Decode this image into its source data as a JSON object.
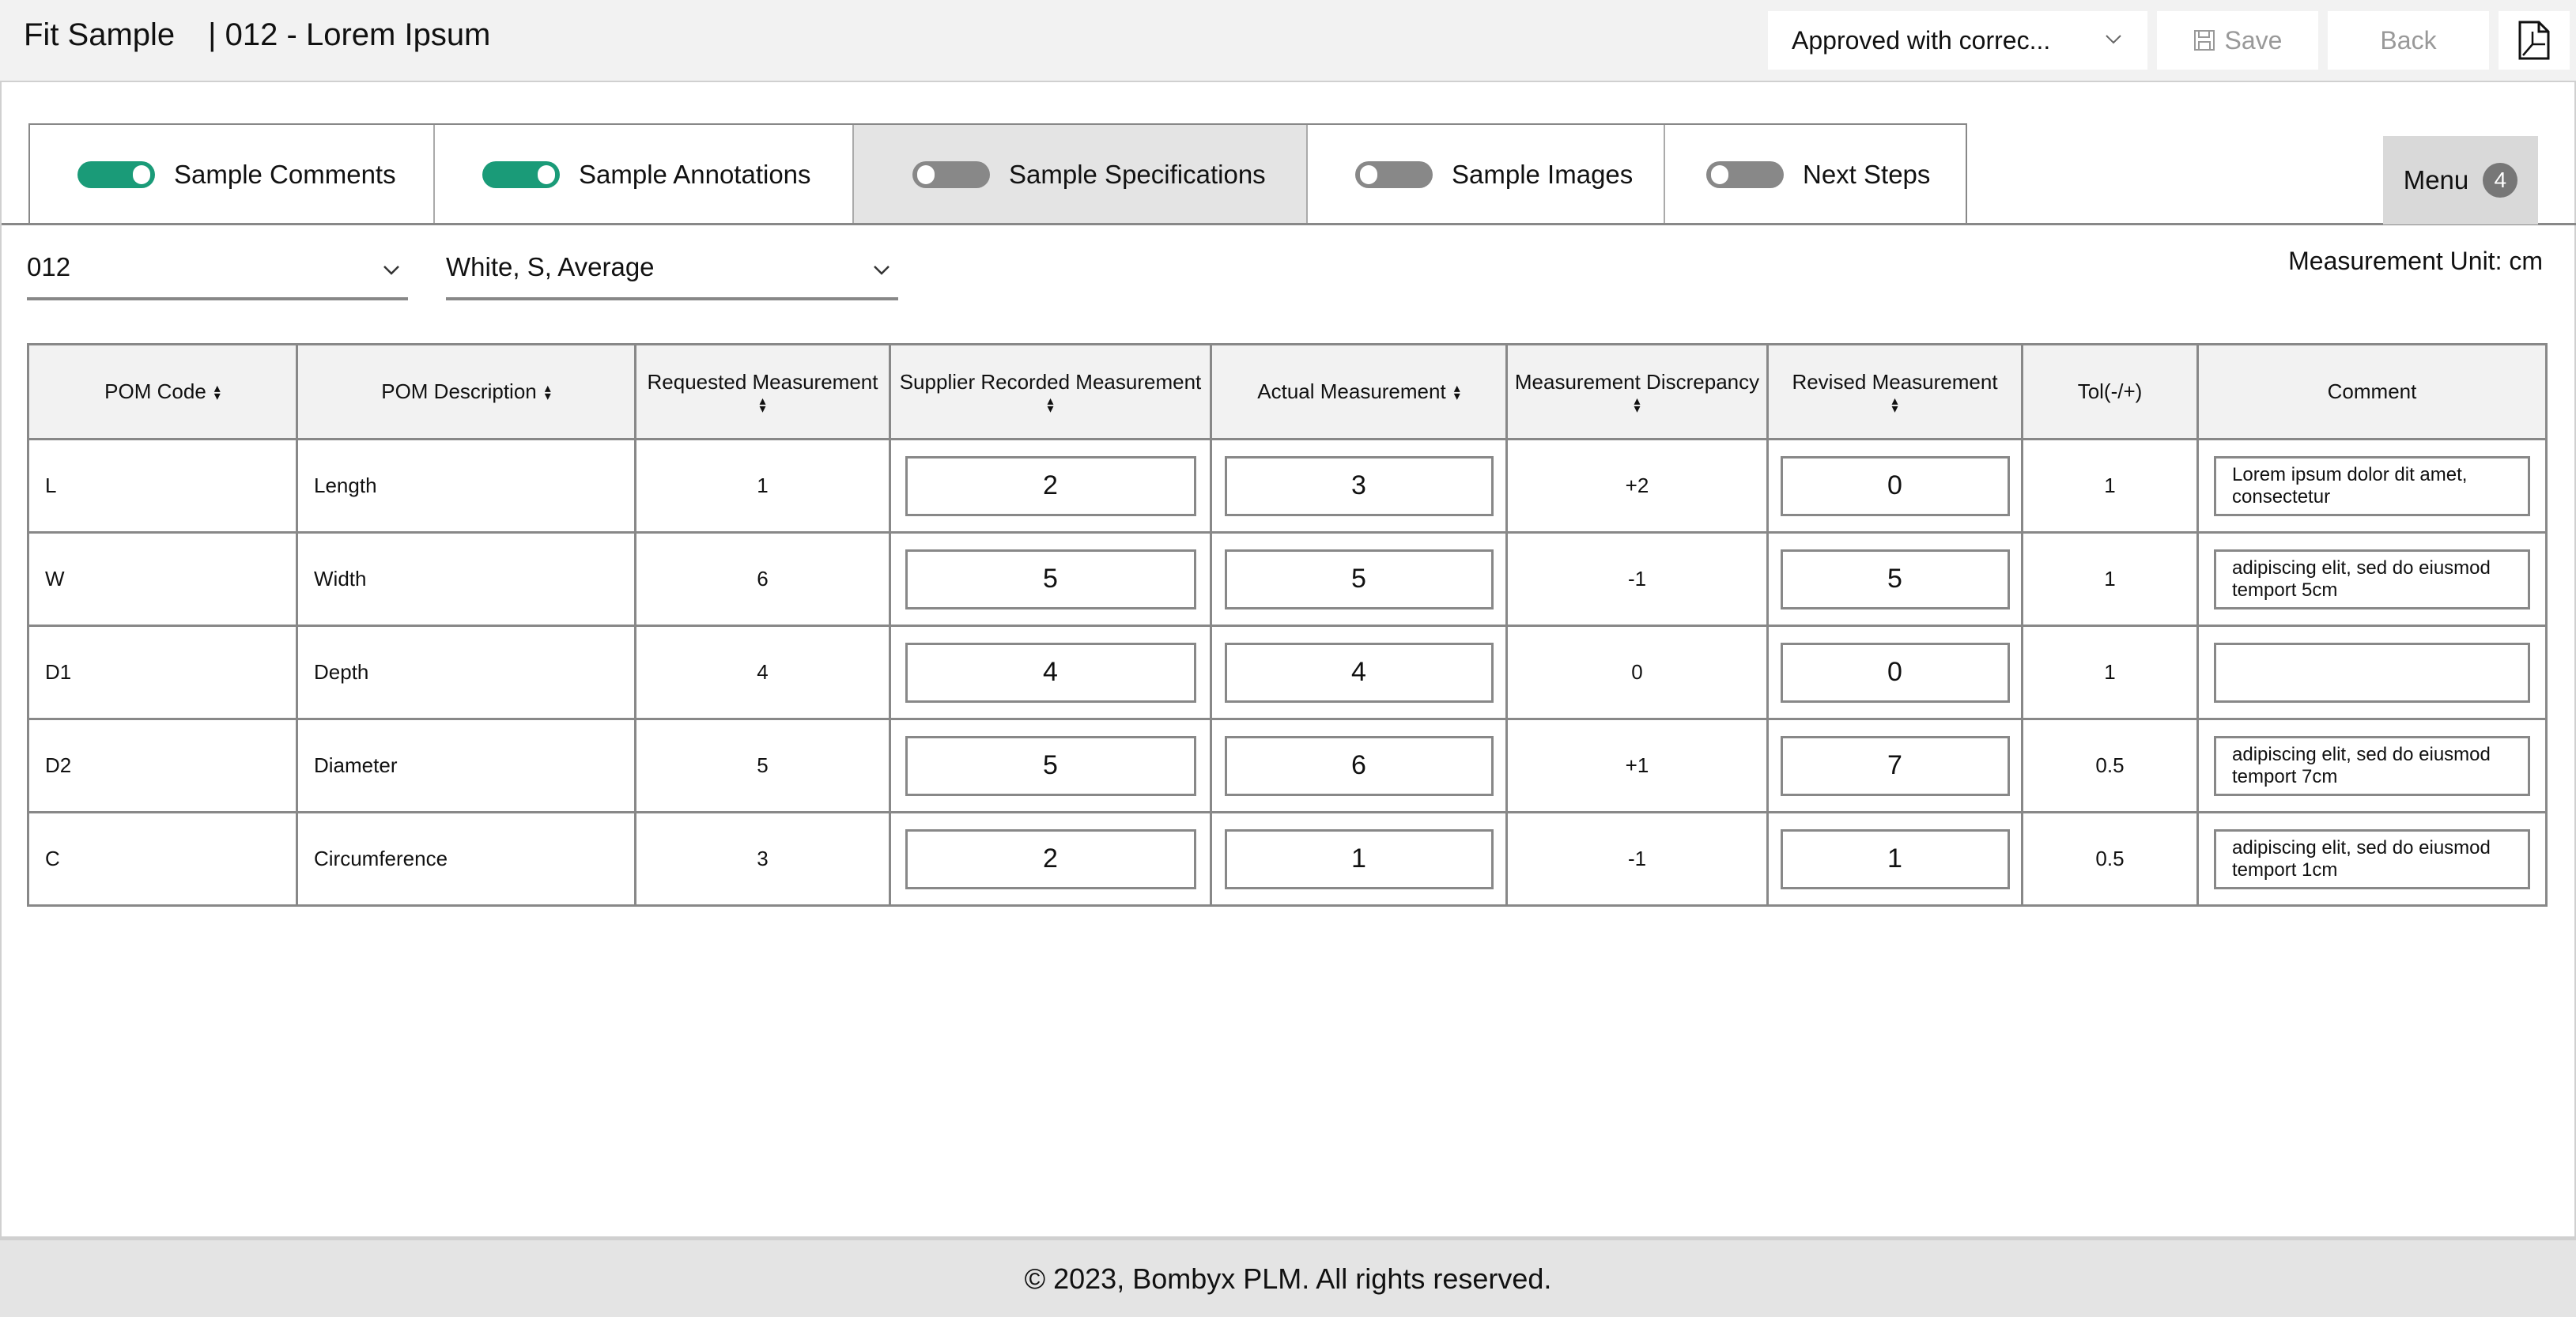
{
  "header": {
    "title": "Fit Sample",
    "subtitle": "| 012 - Lorem Ipsum",
    "status_select": {
      "value": "Approved with correc..."
    },
    "save_label": "Save",
    "back_label": "Back",
    "pdf_icon": "pdf-file-icon"
  },
  "tabs": [
    {
      "label": "Sample Comments",
      "toggle": "on",
      "active": false
    },
    {
      "label": "Sample Annotations",
      "toggle": "on",
      "active": false
    },
    {
      "label": "Sample Specifications",
      "toggle": "off",
      "active": true
    },
    {
      "label": "Sample Images",
      "toggle": "off",
      "active": false
    },
    {
      "label": "Next Steps",
      "toggle": "off",
      "active": false
    }
  ],
  "menu": {
    "label": "Menu",
    "badge": "4"
  },
  "filters": {
    "sample": "012",
    "variant": "White, S, Average"
  },
  "measurement_unit": "Measurement Unit: cm",
  "table": {
    "columns": [
      "POM Code",
      "POM Description",
      "Requested Measurement",
      "Supplier Recorded Measurement",
      "Actual Measurement",
      "Measurement Discrepancy",
      "Revised Measurement",
      "Tol(-/+)",
      "Comment"
    ],
    "rows": [
      {
        "code": "L",
        "description": "Length",
        "requested": "1",
        "supplier": "2",
        "actual": "3",
        "discrepancy": "+2",
        "discrepancy_status": "pos",
        "revised": "0",
        "tol": "1",
        "comment": "Lorem ipsum dolor dit amet,\n consectetur"
      },
      {
        "code": "W",
        "description": "Width",
        "requested": "6",
        "supplier": "5",
        "actual": "5",
        "discrepancy": "-1",
        "discrepancy_status": "neg",
        "revised": "5",
        "tol": "1",
        "comment": "adipiscing elit, sed do eiusmod\ntemport 5cm"
      },
      {
        "code": "D1",
        "description": "Depth",
        "requested": "4",
        "supplier": "4",
        "actual": "4",
        "discrepancy": "0",
        "discrepancy_status": "neg",
        "revised": "0",
        "tol": "1",
        "comment": ""
      },
      {
        "code": "D2",
        "description": "Diameter",
        "requested": "5",
        "supplier": "5",
        "actual": "6",
        "discrepancy": "+1",
        "discrepancy_status": "pos",
        "revised": "7",
        "tol": "0.5",
        "comment": "adipiscing elit, sed do eiusmod\ntemport 7cm"
      },
      {
        "code": "C",
        "description": "Circumference",
        "requested": "3",
        "supplier": "2",
        "actual": "1",
        "discrepancy": "-1",
        "discrepancy_status": "pos",
        "revised": "1",
        "tol": "0.5",
        "comment": "adipiscing elit, sed do eiusmod\ntemport 1cm"
      }
    ]
  },
  "colors": {
    "accent": "#1a9b78",
    "discrepancy_over": "#e8404c",
    "discrepancy_ok": "#1a9b78"
  },
  "footer": {
    "text": "© 2023, Bombyx PLM. All rights reserved."
  }
}
